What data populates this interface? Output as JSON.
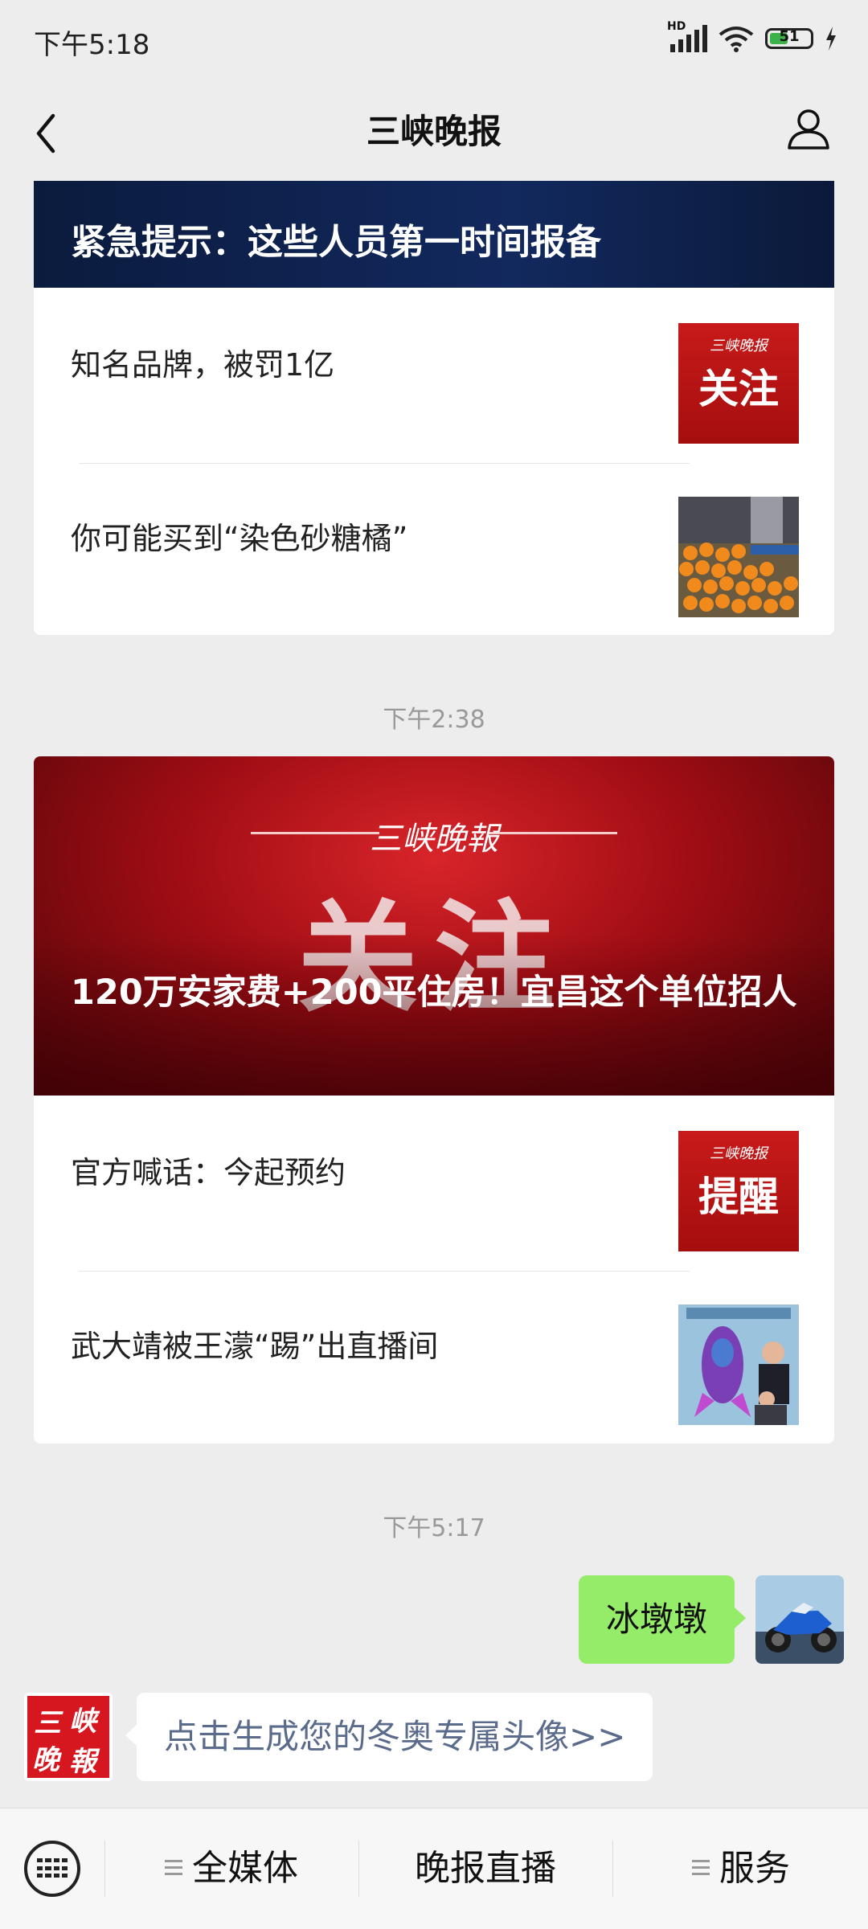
{
  "status_bar": {
    "time": "下午5:18",
    "signal": "HD",
    "battery": "51"
  },
  "header": {
    "title": "三峡晚报"
  },
  "card1": {
    "banner_title": "紧急提示：这些人员第一时间报备",
    "items": [
      {
        "text": "知名品牌，被罚1亿",
        "thumb_small": "三峡晚报",
        "thumb_big": "关注"
      },
      {
        "text": "你可能买到“染色砂糖橘”"
      }
    ]
  },
  "timestamp1": "下午2:38",
  "card2": {
    "banner_masthead": "三峡晚報",
    "banner_word": "关注",
    "banner_title": "120万安家费+200平住房！宜昌这个单位招人",
    "items": [
      {
        "text": "官方喊话：今起预约",
        "thumb_small": "三峡晚报",
        "thumb_big": "提醒"
      },
      {
        "text": "武大靖被王濛“踢”出直播间"
      }
    ]
  },
  "timestamp2": "下午5:17",
  "chat": {
    "sent": "冰墩墩",
    "received": "点击生成您的冬奥专属头像>>",
    "official_logo": [
      "三",
      "峡",
      "晚",
      "報"
    ]
  },
  "bottom_menu": {
    "items": [
      "全媒体",
      "晚报直播",
      "服务"
    ]
  }
}
